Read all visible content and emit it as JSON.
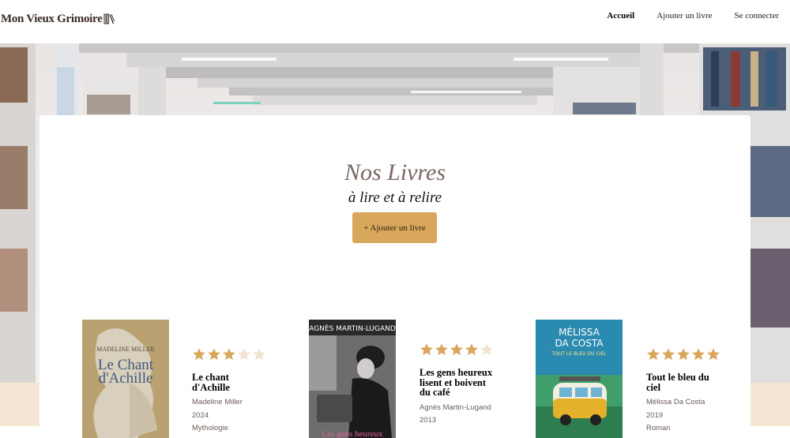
{
  "header": {
    "logo_text": "Mon Vieux Grimoire",
    "nav": [
      {
        "label": "Accueil",
        "active": true
      },
      {
        "label": "Ajouter un livre",
        "active": false
      },
      {
        "label": "Se connecter",
        "active": false
      }
    ]
  },
  "main": {
    "title": "Nos Livres",
    "subtitle": "à lire et à relire",
    "add_button": "+ Ajouter un livre"
  },
  "books": [
    {
      "title": "Le chant d'Achille",
      "author": "Madeline Miller",
      "year": "2024",
      "genre": "Mythologie",
      "rating": 3,
      "cover": {
        "author_text": "MADELINE MILLER",
        "title_line1": "Le Chant",
        "title_line2": "d'Achille"
      }
    },
    {
      "title": "Les gens heureux lisent et boivent du café",
      "author": "Agnès Martin-Lugand",
      "year": "2013",
      "rating": 4,
      "cover": {
        "author_text": "AGNÈS MARTIN-LUGAND",
        "title_line1": "Les gens heureux"
      }
    },
    {
      "title": "Tout le bleu du ciel",
      "author": "Mélissa Da Costa",
      "year": "2019",
      "genre": "Roman",
      "rating": 5,
      "cover": {
        "author_line1": "MÉLISSA",
        "author_line2": "DA COSTA",
        "title_text": "TOUT LE BLEU DU CIEL"
      }
    }
  ],
  "colors": {
    "accent": "#d8a75b",
    "star_filled": "#d8a75b",
    "star_empty": "#f1e3cf",
    "title": "#7a6761"
  }
}
